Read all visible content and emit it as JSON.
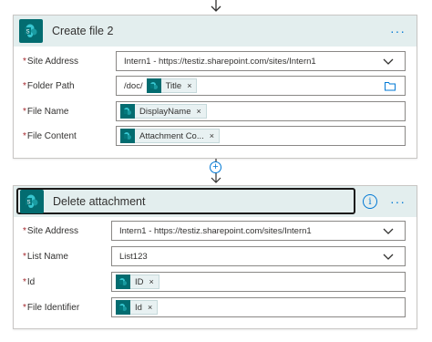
{
  "create_file": {
    "title": "Create file 2",
    "menu": "···",
    "site_address_label": "Site Address",
    "site_address_value": "Intern1 - https://testiz.sharepoint.com/sites/Intern1",
    "folder_path_label": "Folder Path",
    "folder_path_prefix": "/doc/",
    "folder_path_token": "Title",
    "file_name_label": "File Name",
    "file_name_token": "DisplayName",
    "file_content_label": "File Content",
    "file_content_token": "Attachment Co..."
  },
  "delete_attachment": {
    "title": "Delete attachment",
    "info": "i",
    "menu": "···",
    "site_address_label": "Site Address",
    "site_address_value": "Intern1 - https://testiz.sharepoint.com/sites/Intern1",
    "list_name_label": "List Name",
    "list_name_value": "List123",
    "id_label": "Id",
    "id_token": "ID",
    "file_identifier_label": "File Identifier",
    "file_identifier_token": "Id"
  },
  "common": {
    "required_mark": "*",
    "token_remove": "×",
    "insert_step": "+"
  },
  "colors": {
    "sharepoint": "#036c70",
    "header_bg": "#e3eeee",
    "accent": "#0078d4"
  }
}
